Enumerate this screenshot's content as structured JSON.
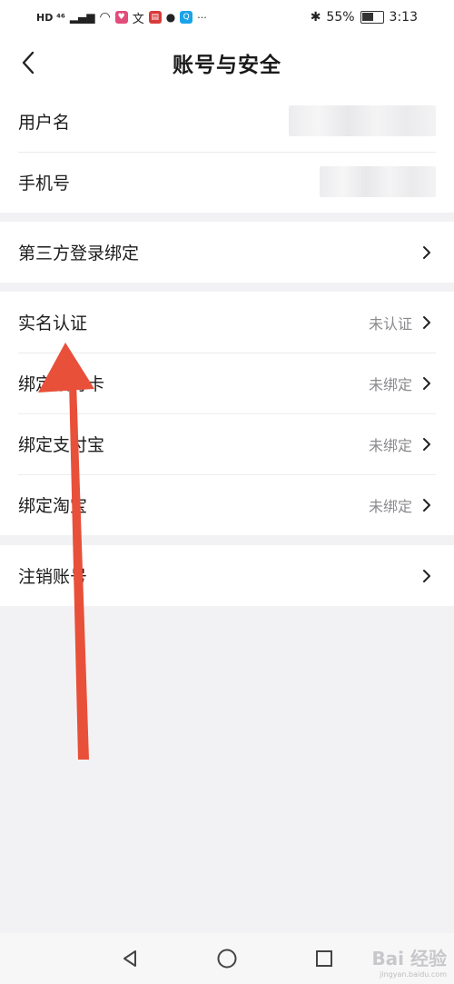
{
  "status_bar": {
    "left_text": "HD ⁴⁶",
    "battery": "55%",
    "time": "3:13",
    "more": "···"
  },
  "header": {
    "title": "账号与安全"
  },
  "groups": {
    "account": {
      "username_label": "用户名",
      "phone_label": "手机号"
    },
    "third_party": {
      "label": "第三方登录绑定"
    },
    "verification": {
      "realname_label": "实名认证",
      "realname_value": "未认证",
      "bank_label": "绑定银行卡",
      "bank_value": "未绑定",
      "alipay_label": "绑定支付宝",
      "alipay_value": "未绑定",
      "taobao_label": "绑定淘宝",
      "taobao_value": "未绑定"
    },
    "cancel": {
      "label": "注销账号"
    }
  },
  "watermark": {
    "brand": "Bai 经验",
    "url": "jingyan.baidu.com"
  },
  "colors": {
    "accent_arrow": "#e8503a",
    "background": "#f2f2f4"
  },
  "icons": [
    "back-icon",
    "chevron-right-icon",
    "nav-back-icon",
    "nav-home-icon",
    "nav-recent-icon"
  ]
}
